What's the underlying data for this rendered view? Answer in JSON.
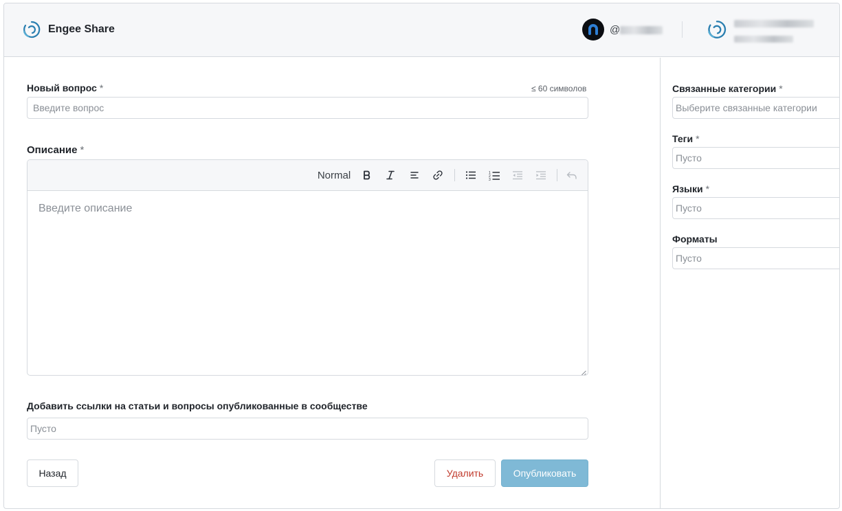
{
  "header": {
    "app_title": "Engee Share",
    "username_prefix": "@",
    "icons": {
      "logo": "engee-logo-icon",
      "avatar": "user-avatar-icon",
      "org_logo": "org-logo-icon"
    },
    "accent_color": "#2a7fb0"
  },
  "question": {
    "label": "Новый вопрос",
    "required_mark": "*",
    "limit_hint": "≤ 60 символов",
    "placeholder": "Введите вопрос",
    "value": ""
  },
  "description": {
    "label": "Описание",
    "required_mark": "*",
    "placeholder": "Введите описание",
    "toolbar": {
      "format_label": "Normal",
      "bold_label": "B",
      "italic_label": "I",
      "icons": [
        "bold-icon",
        "italic-icon",
        "align-icon",
        "link-icon",
        "bullet-list-icon",
        "ordered-list-icon",
        "outdent-icon",
        "indent-icon",
        "undo-icon"
      ]
    }
  },
  "links": {
    "label": "Добавить ссылки на статьи и вопросы опубликованные в сообществе",
    "placeholder": "Пусто"
  },
  "actions": {
    "back_label": "Назад",
    "delete_label": "Удалить",
    "publish_label": "Опубликовать",
    "publish_color": "#7fb9d6",
    "delete_color": "#c0392b"
  },
  "sidebar": {
    "categories": {
      "label": "Связанные категории",
      "required_mark": "*",
      "placeholder": "Выберите связанные категории"
    },
    "tags": {
      "label": "Теги",
      "required_mark": "*",
      "placeholder": "Пусто"
    },
    "languages": {
      "label": "Языки",
      "required_mark": "*",
      "placeholder": "Пусто"
    },
    "formats": {
      "label": "Форматы",
      "placeholder": "Пусто"
    }
  }
}
